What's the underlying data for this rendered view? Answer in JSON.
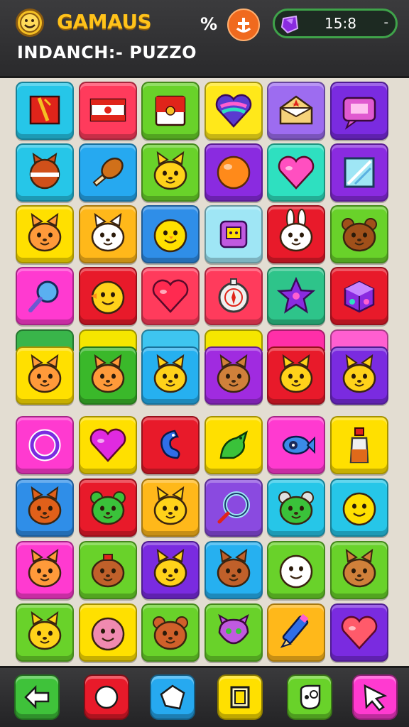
{
  "header": {
    "title": "GAMAUS",
    "subtitle": "INDANCH:- PUZZO",
    "percent_label": "%",
    "timer": "15:8",
    "timer_arrow": "-"
  },
  "header_icons": {
    "logo": "smiley-coin-icon",
    "anchor": "anchor-icon",
    "gem": "purple-gem-icon"
  },
  "colors": {
    "title": "#ffc21a",
    "topbar": "#2f2f31",
    "board_bg": "#e3ddd2",
    "timer_border": "#3fa34a"
  },
  "peek_row": [
    "#39b54a",
    "#f5e600",
    "#3ec5f0",
    "#f5e600",
    "#ff2fa8",
    "#ff5fd0"
  ],
  "board": [
    [
      {
        "bg": "#26c6e8",
        "icon": "flag-red"
      },
      {
        "bg": "#ff3b5c",
        "icon": "flag-banner"
      },
      {
        "bg": "#69d22a",
        "icon": "flag-red-white"
      },
      {
        "bg": "#ffe81a",
        "icon": "heart-rainbow"
      },
      {
        "bg": "#9d6cf0",
        "icon": "envelope-star"
      },
      {
        "bg": "#7a2be0",
        "icon": "chat-bubble-pink"
      }
    ],
    [
      {
        "bg": "#26c6e8",
        "icon": "fox-ball"
      },
      {
        "bg": "#26a9f0",
        "icon": "drumstick"
      },
      {
        "bg": "#69d22a",
        "icon": "cat-yellow"
      },
      {
        "bg": "#8a2be0",
        "icon": "orange-ball"
      },
      {
        "bg": "#2ee0c0",
        "icon": "heart-pink"
      },
      {
        "bg": "#8a2be0",
        "icon": "mirror-square"
      }
    ],
    [
      {
        "bg": "#ffe000",
        "icon": "cat-orange"
      },
      {
        "bg": "#ffb81a",
        "icon": "cat-white"
      },
      {
        "bg": "#2f8ee8",
        "icon": "chick-face"
      },
      {
        "bg": "#9fe6f5",
        "icon": "robot-face"
      },
      {
        "bg": "#e81a2a",
        "icon": "bunny-white"
      },
      {
        "bg": "#69d22a",
        "icon": "bear-brown"
      }
    ],
    [
      {
        "bg": "#ff3ad0",
        "icon": "magnifier-blue"
      },
      {
        "bg": "#e81a2a",
        "icon": "chick-yellow"
      },
      {
        "bg": "#ff3b5c",
        "icon": "heart-red"
      },
      {
        "bg": "#ff3b5c",
        "icon": "compass-badge"
      },
      {
        "bg": "#2ec48a",
        "icon": "star-purple"
      },
      {
        "bg": "#e81a2a",
        "icon": "gift-cube"
      }
    ],
    [
      {
        "bg": "#ffe000",
        "icon": "cat-orange"
      },
      {
        "bg": "#3ab82a",
        "icon": "cat-orange"
      },
      {
        "bg": "#26b0f0",
        "icon": "cat-yellow"
      },
      {
        "bg": "#a02be0",
        "icon": "cat-brown"
      },
      {
        "bg": "#e81a2a",
        "icon": "cat-yellow"
      },
      {
        "bg": "#7a2be0",
        "icon": "cat-yellow"
      }
    ],
    [
      {
        "bg": "#ff3ad0",
        "icon": "ring-purple"
      },
      {
        "bg": "#ffe000",
        "icon": "heart-magenta"
      },
      {
        "bg": "#e81a2a",
        "icon": "seahorse-blue"
      },
      {
        "bg": "#ffe000",
        "icon": "dragon-green"
      },
      {
        "bg": "#ff3ad0",
        "icon": "fish-blue"
      },
      {
        "bg": "#ffe000",
        "icon": "bottle"
      }
    ],
    [
      {
        "bg": "#2f8ee8",
        "icon": "fox-orange"
      },
      {
        "bg": "#e81a2a",
        "icon": "frog-green"
      },
      {
        "bg": "#ffb81a",
        "icon": "cat-yellow"
      },
      {
        "bg": "#8a4ae0",
        "icon": "ring-blue"
      },
      {
        "bg": "#26c6e8",
        "icon": "mouse-green"
      },
      {
        "bg": "#26c6e8",
        "icon": "smiley-yellow"
      }
    ],
    [
      {
        "bg": "#ff3ad0",
        "icon": "cat-orange"
      },
      {
        "bg": "#69d22a",
        "icon": "acorn-face"
      },
      {
        "bg": "#7a2be0",
        "icon": "cat-yellow"
      },
      {
        "bg": "#26b0f0",
        "icon": "fox-brown"
      },
      {
        "bg": "#69d22a",
        "icon": "ghost-white"
      },
      {
        "bg": "#69d22a",
        "icon": "cat-brown"
      }
    ],
    [
      {
        "bg": "#69d22a",
        "icon": "cat-yellow"
      },
      {
        "bg": "#ffe000",
        "icon": "ball-pink"
      },
      {
        "bg": "#69d22a",
        "icon": "bear-orange"
      },
      {
        "bg": "#69d22a",
        "icon": "monster-purple"
      },
      {
        "bg": "#ffb81a",
        "icon": "pencil-blue"
      },
      {
        "bg": "#7a2be0",
        "icon": "heart-coral"
      }
    ]
  ],
  "toolbar": [
    {
      "name": "back-button",
      "bg": "#3fc23a",
      "icon": "arrow-left-icon"
    },
    {
      "name": "record-button",
      "bg": "#e81a2a",
      "icon": "circle-icon"
    },
    {
      "name": "shape-button",
      "bg": "#26a9f0",
      "icon": "star-outline-icon"
    },
    {
      "name": "square-button",
      "bg": "#ffe000",
      "icon": "square-icon"
    },
    {
      "name": "sticker-button",
      "bg": "#69d22a",
      "icon": "sticker-icon"
    },
    {
      "name": "cursor-button",
      "bg": "#ff3ad0",
      "icon": "cursor-icon"
    }
  ]
}
